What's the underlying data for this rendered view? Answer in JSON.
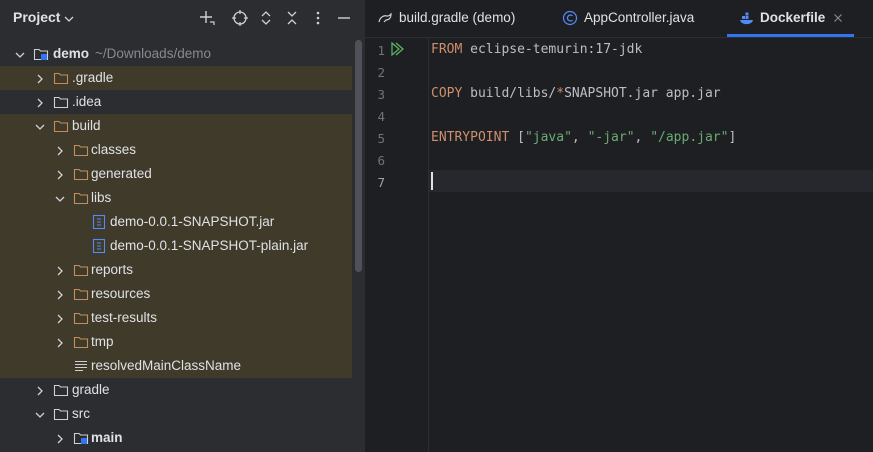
{
  "project": {
    "title": "Project",
    "tree": [
      {
        "name": "demo",
        "note": "~/Downloads/demo"
      },
      {
        "name": ".gradle"
      },
      {
        "name": ".idea"
      },
      {
        "name": "build"
      },
      {
        "name": "classes"
      },
      {
        "name": "generated"
      },
      {
        "name": "libs"
      },
      {
        "name": "demo-0.0.1-SNAPSHOT.jar"
      },
      {
        "name": "demo-0.0.1-SNAPSHOT-plain.jar"
      },
      {
        "name": "reports"
      },
      {
        "name": "resources"
      },
      {
        "name": "test-results"
      },
      {
        "name": "tmp"
      },
      {
        "name": "resolvedMainClassName"
      },
      {
        "name": "gradle"
      },
      {
        "name": "src"
      },
      {
        "name": "main"
      }
    ]
  },
  "tabs": [
    {
      "label": "build.gradle (demo)",
      "icon": "gradle-icon"
    },
    {
      "label": "AppController.java",
      "icon": "java-class-icon"
    },
    {
      "label": "Dockerfile",
      "icon": "docker-icon",
      "active": true
    }
  ],
  "editor": {
    "line_numbers": [
      "1",
      "2",
      "3",
      "4",
      "5",
      "6",
      "7"
    ],
    "current_line": "7",
    "lines": {
      "l1": {
        "kw": "FROM",
        "rest": " eclipse-temurin:17-jdk"
      },
      "l3": {
        "kw": "COPY",
        "rest_a": " build/libs/",
        "star": "*",
        "rest_b": "SNAPSHOT.jar app.jar"
      },
      "l5": {
        "kw": "ENTRYPOINT",
        "open": " [",
        "s1": "\"java\"",
        "c1": ", ",
        "s2": "\"-jar\"",
        "c2": ", ",
        "s3": "\"/app.jar\"",
        "close": "]"
      }
    }
  },
  "colors": {
    "accent": "#3574f0",
    "keyword": "#cf8e6d",
    "string": "#6aab73",
    "folder": "#c78c5b",
    "highlight": "#3f3a2a"
  }
}
